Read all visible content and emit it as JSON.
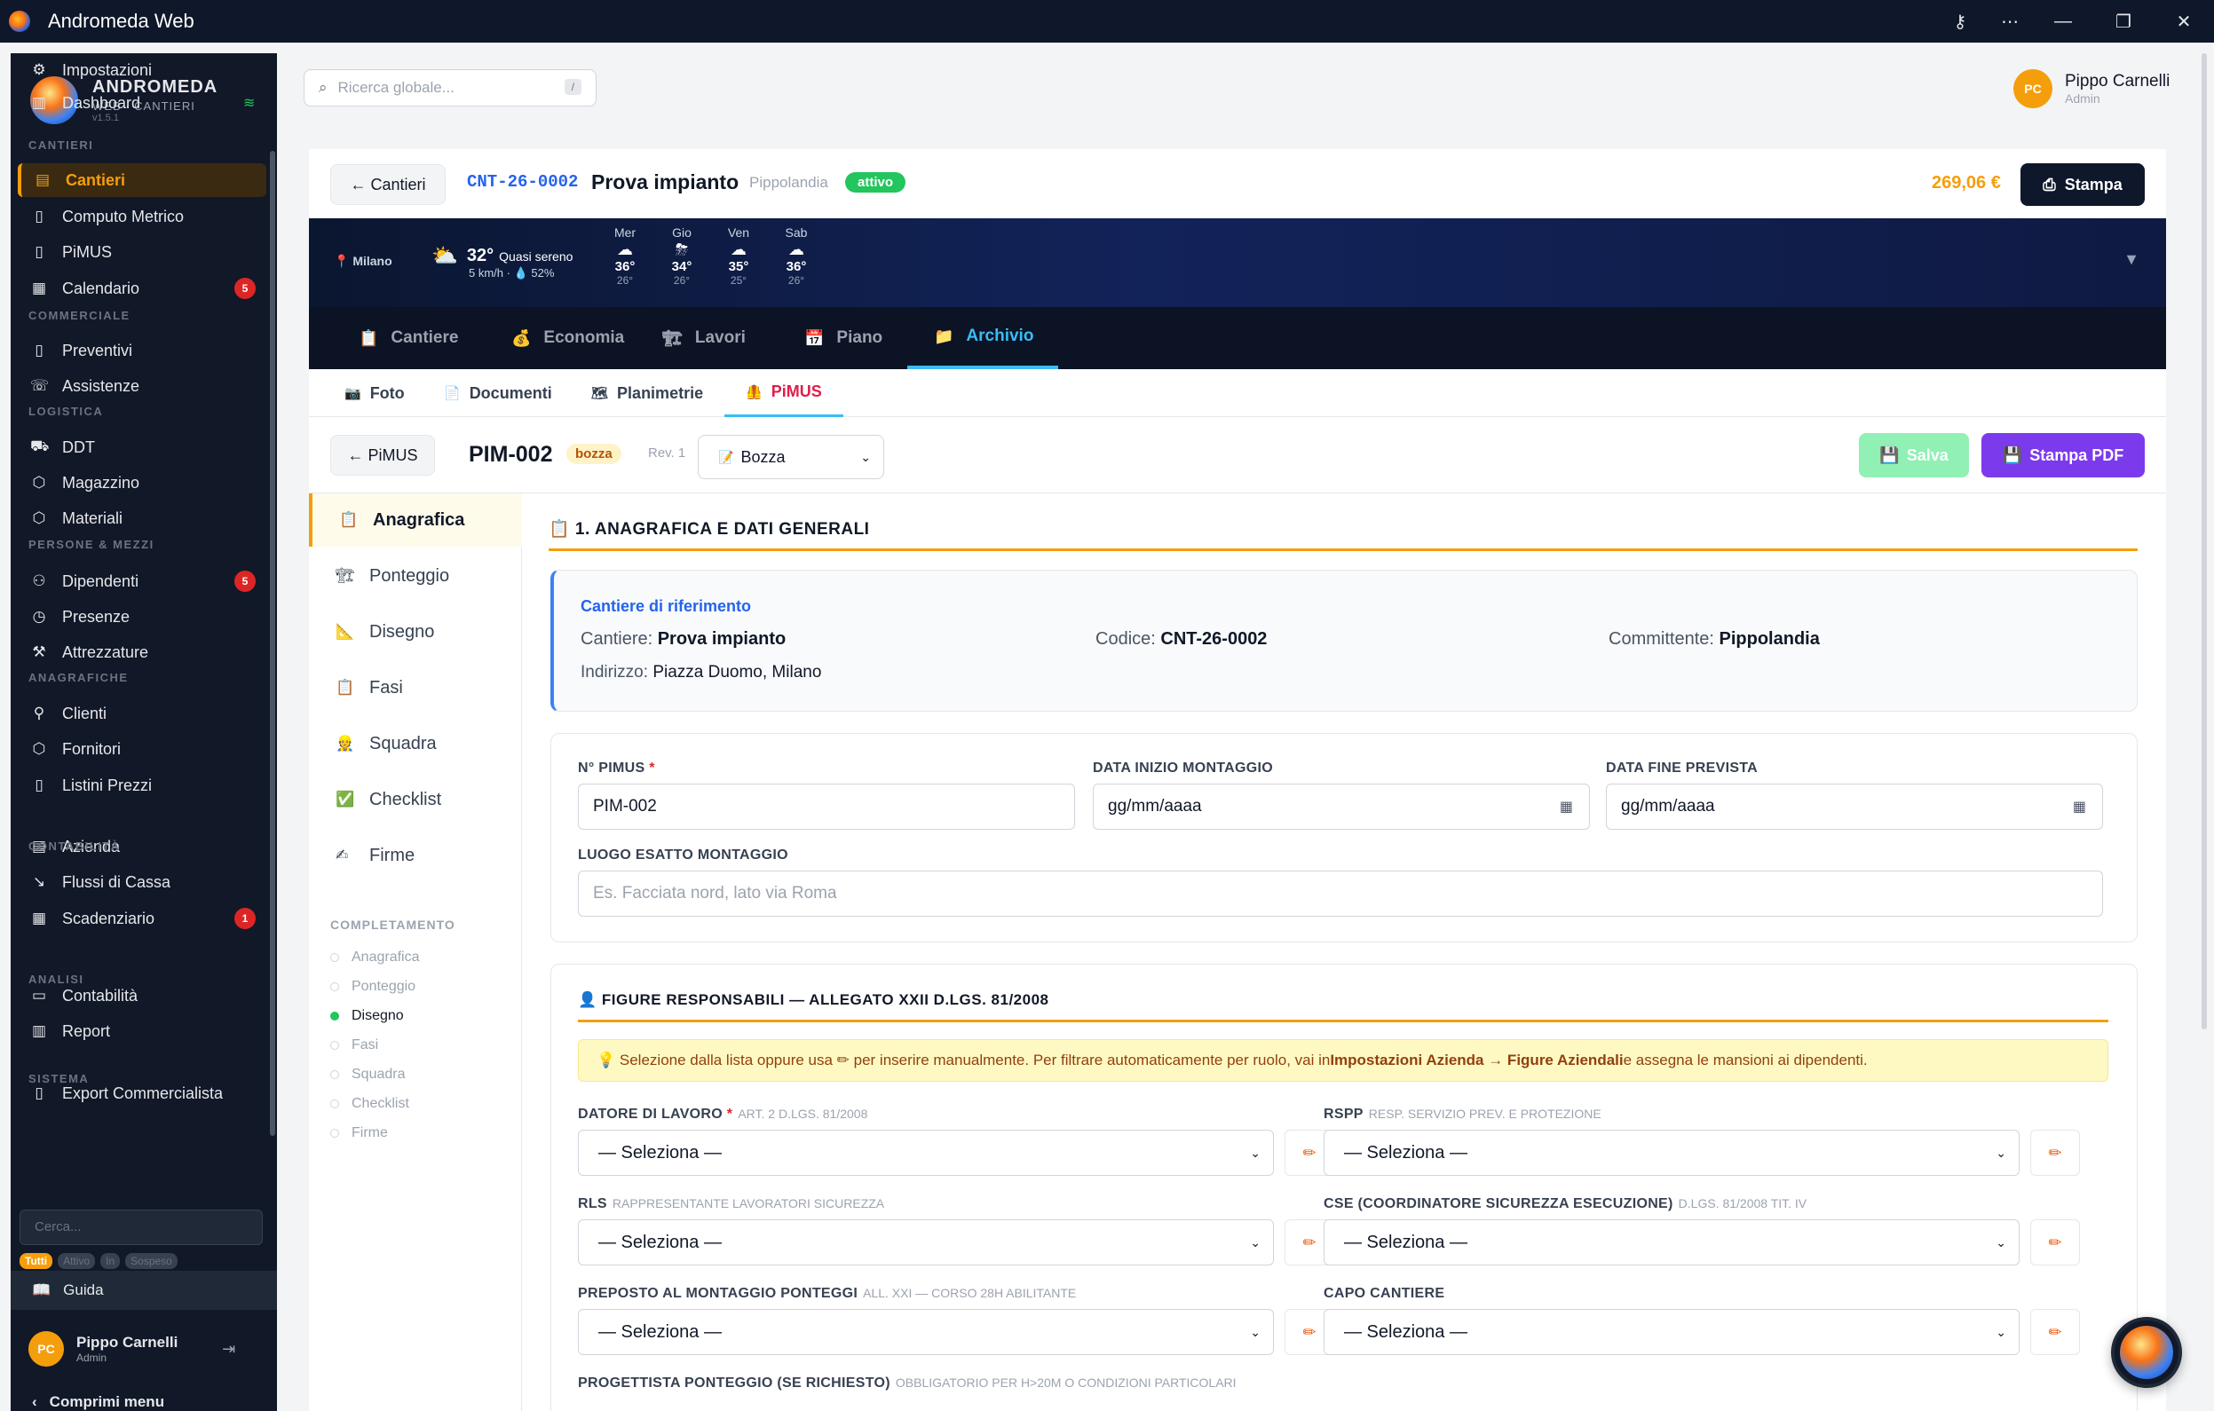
{
  "window": {
    "title": "Andromeda Web"
  },
  "brand": {
    "name": "ANDROMEDA",
    "sub": "WEB · CANTIERI",
    "version": "v1.5.1"
  },
  "sidebar": {
    "items": [
      {
        "label": "Dashboard",
        "icon": "chart-icon"
      },
      {
        "section": "CANTIERI"
      },
      {
        "label": "Cantieri",
        "icon": "building-icon",
        "active": true
      },
      {
        "label": "Computo Metrico",
        "icon": "document-icon"
      },
      {
        "label": "PiMUS",
        "icon": "document-icon"
      },
      {
        "label": "Calendario",
        "icon": "calendar-icon",
        "badge": "5"
      },
      {
        "section": "COMMERCIALE"
      },
      {
        "label": "Preventivi",
        "icon": "document-icon"
      },
      {
        "label": "Assistenze",
        "icon": "phone-icon"
      },
      {
        "section": "LOGISTICA"
      },
      {
        "label": "DDT",
        "icon": "truck-icon"
      },
      {
        "label": "Magazzino",
        "icon": "box-icon"
      },
      {
        "label": "Materiali",
        "icon": "box-icon"
      },
      {
        "section": "PERSONE & MEZZI"
      },
      {
        "label": "Dipendenti",
        "icon": "users-icon",
        "badge": "5"
      },
      {
        "label": "Presenze",
        "icon": "clock-icon"
      },
      {
        "label": "Attrezzature",
        "icon": "wrench-icon"
      },
      {
        "section": "ANAGRAFICHE"
      },
      {
        "label": "Clienti",
        "icon": "user-icon"
      },
      {
        "label": "Fornitori",
        "icon": "box-icon"
      },
      {
        "label": "Listini Prezzi",
        "icon": "document-icon"
      },
      {
        "label": "Azienda",
        "icon": "building-icon"
      },
      {
        "section": "CONTABILITÀ"
      },
      {
        "label": "Flussi di Cassa",
        "icon": "trend-icon"
      },
      {
        "label": "Scadenziario",
        "icon": "calendar-icon",
        "badge": "1"
      },
      {
        "label": "Contabilità",
        "icon": "book-icon"
      },
      {
        "section": "ANALISI"
      },
      {
        "label": "Report",
        "icon": "chart-icon"
      },
      {
        "label": "Export Commercialista",
        "icon": "document-icon"
      },
      {
        "section": "SISTEMA"
      },
      {
        "label": "Impostazioni",
        "icon": "gear-icon"
      }
    ],
    "search_placeholder": "Cerca...",
    "filters": [
      "Tutti",
      "Attivo",
      "In",
      "Sospeso"
    ],
    "guide": "Guida",
    "user": {
      "name": "Pippo Carnelli",
      "role": "Admin",
      "initials": "PC"
    },
    "collapse": "Comprimi menu"
  },
  "topbar": {
    "search_placeholder": "Ricerca globale...",
    "search_kbd": "/",
    "user": {
      "name": "Pippo Carnelli",
      "role": "Admin",
      "initials": "PC"
    }
  },
  "header": {
    "back": "← Cantieri",
    "code": "CNT-26-0002",
    "title": "Prova impianto",
    "location": "Pippolandia",
    "status": "attivo",
    "total": "269,06 €",
    "print": "Stampa"
  },
  "weather": {
    "city": "Milano",
    "temp": "32°",
    "desc": "Quasi sereno",
    "sub": "5 km/h · 💧 52%",
    "days": [
      {
        "d": "Mer",
        "h": "36°",
        "l": "26°",
        "ic": "☁"
      },
      {
        "d": "Gio",
        "h": "34°",
        "l": "26°",
        "ic": "⛈"
      },
      {
        "d": "Ven",
        "h": "35°",
        "l": "25°",
        "ic": "☁"
      },
      {
        "d": "Sab",
        "h": "36°",
        "l": "26°",
        "ic": "☁"
      }
    ]
  },
  "tabs": [
    {
      "label": "Cantiere",
      "icon": "📋"
    },
    {
      "label": "Economia",
      "icon": "💰"
    },
    {
      "label": "Lavori",
      "icon": "🏗"
    },
    {
      "label": "Piano",
      "icon": "📅"
    },
    {
      "label": "Archivio",
      "icon": "📁",
      "active": true
    }
  ],
  "subtabs": [
    {
      "label": "Foto",
      "icon": "📷"
    },
    {
      "label": "Documenti",
      "icon": "📄"
    },
    {
      "label": "Planimetrie",
      "icon": "🗺"
    },
    {
      "label": "PiMUS",
      "icon": "🦺",
      "active": true
    }
  ],
  "pimus": {
    "back": "← PiMUS",
    "code": "PIM-002",
    "status_badge": "bozza",
    "rev": "Rev. 1",
    "status_select": "Bozza",
    "save": "Salva",
    "print_pdf": "Stampa PDF"
  },
  "leftnav": [
    {
      "label": "Anagrafica",
      "icon": "📋",
      "active": true
    },
    {
      "label": "Ponteggio",
      "icon": "🏗"
    },
    {
      "label": "Disegno",
      "icon": "📐"
    },
    {
      "label": "Fasi",
      "icon": "📋"
    },
    {
      "label": "Squadra",
      "icon": "👷"
    },
    {
      "label": "Checklist",
      "icon": "✅"
    },
    {
      "label": "Firme",
      "icon": "✍"
    }
  ],
  "completion": {
    "title": "COMPLETAMENTO",
    "items": [
      {
        "label": "Anagrafica"
      },
      {
        "label": "Ponteggio"
      },
      {
        "label": "Disegno",
        "done": true
      },
      {
        "label": "Fasi"
      },
      {
        "label": "Squadra"
      },
      {
        "label": "Checklist"
      },
      {
        "label": "Firme"
      }
    ]
  },
  "section1": {
    "title": "📋 1. ANAGRAFICA E DATI GENERALI",
    "info": {
      "heading": "Cantiere di riferimento",
      "cantiere_label": "Cantiere:",
      "cantiere": "Prova impianto",
      "codice_label": "Codice:",
      "codice": "CNT-26-0002",
      "committente_label": "Committente:",
      "committente": "Pippolandia",
      "indirizzo_label": "Indirizzo:",
      "indirizzo": "Piazza Duomo, Milano"
    },
    "fields": {
      "npimus_label": "N° PIMUS",
      "npimus_req": "*",
      "npimus": "PIM-002",
      "data_inizio_label": "DATA INIZIO MONTAGGIO",
      "data_inizio": "gg/mm/aaaa",
      "data_fine_label": "DATA FINE PREVISTA",
      "data_fine": "gg/mm/aaaa",
      "luogo_label": "LUOGO ESATTO MONTAGGIO",
      "luogo_placeholder": "Es. Facciata nord, lato via Roma"
    }
  },
  "section2": {
    "title": "👤 FIGURE RESPONSABILI — ALLEGATO XXII D.LGS. 81/2008",
    "tip": {
      "pre": "💡 Selezione dalla lista oppure usa ✏ per inserire manualmente. Per filtrare automaticamente per ruolo, vai in ",
      "link": "Impostazioni Azienda → Figure Aziendali",
      "post": " e assegna le mansioni ai dipendenti."
    },
    "roles": [
      {
        "label": "DATORE DI LAVORO",
        "req": "*",
        "hint": "ART. 2 D.LGS. 81/2008",
        "value": "— Seleziona —"
      },
      {
        "label": "RSPP",
        "hint": "RESP. SERVIZIO PREV. E PROTEZIONE",
        "value": "— Seleziona —"
      },
      {
        "label": "RLS",
        "hint": "RAPPRESENTANTE LAVORATORI SICUREZZA",
        "value": "— Seleziona —"
      },
      {
        "label": "CSE (COORDINATORE SICUREZZA ESECUZIONE)",
        "hint": "D.LGS. 81/2008 TIT. IV",
        "value": "— Seleziona —"
      },
      {
        "label": "PREPOSTO AL MONTAGGIO PONTEGGI",
        "hint": "ALL. XXI — CORSO 28H ABILITANTE",
        "value": "— Seleziona —"
      },
      {
        "label": "CAPO CANTIERE",
        "hint": "",
        "value": "— Seleziona —"
      },
      {
        "label": "PROGETTISTA PONTEGGIO (SE RICHIESTO)",
        "hint": "OBBLIGATORIO PER H>20M O CONDIZIONI PARTICOLARI"
      }
    ]
  }
}
